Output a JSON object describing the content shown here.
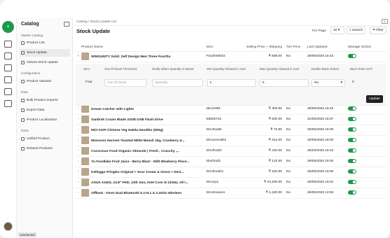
{
  "sidebar": {
    "title": "Catalog",
    "sections": [
      {
        "label": "Master Catalog",
        "items": [
          "Product List",
          "Stock Update",
          "Variant Stock Update"
        ]
      },
      {
        "label": "Configuration",
        "items": [
          "Product Variants"
        ]
      },
      {
        "label": "Data",
        "items": [
          "Bulk Product Imports",
          "Export Data",
          "Product Localization"
        ]
      },
      {
        "label": "Extra",
        "items": [
          "Unified Product",
          "Related Products"
        ]
      }
    ],
    "active": "Stock Update",
    "status": "unselected"
  },
  "breadcrumb": {
    "root": "Catalog",
    "sep": "/",
    "current": "Stocks Update List"
  },
  "header": {
    "title": "Stock Update",
    "per_page_label": "Per Page",
    "per_page": "10",
    "search": "Search",
    "filter": "Filter"
  },
  "columns": [
    "Product Name",
    "SKU",
    "Selling Price + Shipping",
    "Tier Price",
    "Last Updated",
    "Manage Stocks"
  ],
  "expanded": {
    "name": "WINSUNITY Solid_Self Design Men Three Fourths",
    "sku": "Fourths9034",
    "price": "₹ 689.00",
    "tier": "No",
    "updated": "29/05/2025 15:43",
    "fields": [
      "SKU",
      "Out Of Stock Threshold",
      "Notify When Quantity is Below",
      "Min Quantity Allowed in Cart",
      "Max Quantity Allowed in Cart",
      "Enable Back Orders",
      "Back Order QTY"
    ],
    "values": {
      "sku": "Four",
      "oos": "Out Of Stock",
      "notify": "Quantity",
      "min": "1",
      "max": "5",
      "back": "No",
      "qty": "0"
    },
    "update": "Update"
  },
  "rows": [
    {
      "name": "Dream Catcher with Lights",
      "sku": "decor005",
      "price": "₹ 300.00",
      "tier": "No",
      "updated": "29/05/2025 15:43"
    },
    {
      "name": "SanDisk Cruzer Blade 32GB USB Flash Drive",
      "sku": "93845734",
      "price": "₹ 500.00",
      "tier": "No",
      "updated": "31/05/2025 18:37"
    },
    {
      "name": "MOI SOFI Chinese Veg Hakka Noodles (500g)",
      "sku": "SKUfood5",
      "price": "₹ 73.00",
      "tier": "No",
      "updated": "30/05/2025 16:00"
    },
    {
      "name": "Monsoon Harvest Toasted Millet Muesli 1kg, Cranberry &...",
      "sku": "SKUcereal04",
      "price": "₹ 312.00",
      "tier": "No",
      "updated": "26/05/2025 16:00"
    },
    {
      "name": "Conscious Food Organic Almonds | Fresh , Crunchy ,...",
      "sku": "SKUfood3",
      "price": "₹ 432.00",
      "tier": "No",
      "updated": "26/03/2025 16:10"
    },
    {
      "name": "Yu Foodlabs Fruit Juice - Berry Blast - With Blueberry Piece...",
      "sku": "Skufood2",
      "price": "₹ 132.00",
      "tier": "No",
      "updated": "29/05/2025 16:00"
    },
    {
      "name": "Kelloggs Pringles Original + Sour Cream & Onion + Desi...",
      "sku": "SKUfood01",
      "price": "₹ 332.00",
      "tier": "No",
      "updated": "26/05/2025 16:00"
    },
    {
      "name": "ASUS A3402, 23.8\" FHD, 13th Gen, Intel Core i3-1315U, All-i...",
      "sku": "SKUcp1",
      "price": "₹ 43,200.00",
      "tier": "No",
      "updated": "26/05/2025 15:01"
    },
    {
      "name": "Offbeat - Atom Dual Bluetooth 5.1+5.1 & 2.4Ghz Wireless",
      "sku": "SKUmouse1",
      "price": "₹ 1,320.00",
      "tier": "No",
      "updated": "29/05/2025 12:53"
    }
  ]
}
